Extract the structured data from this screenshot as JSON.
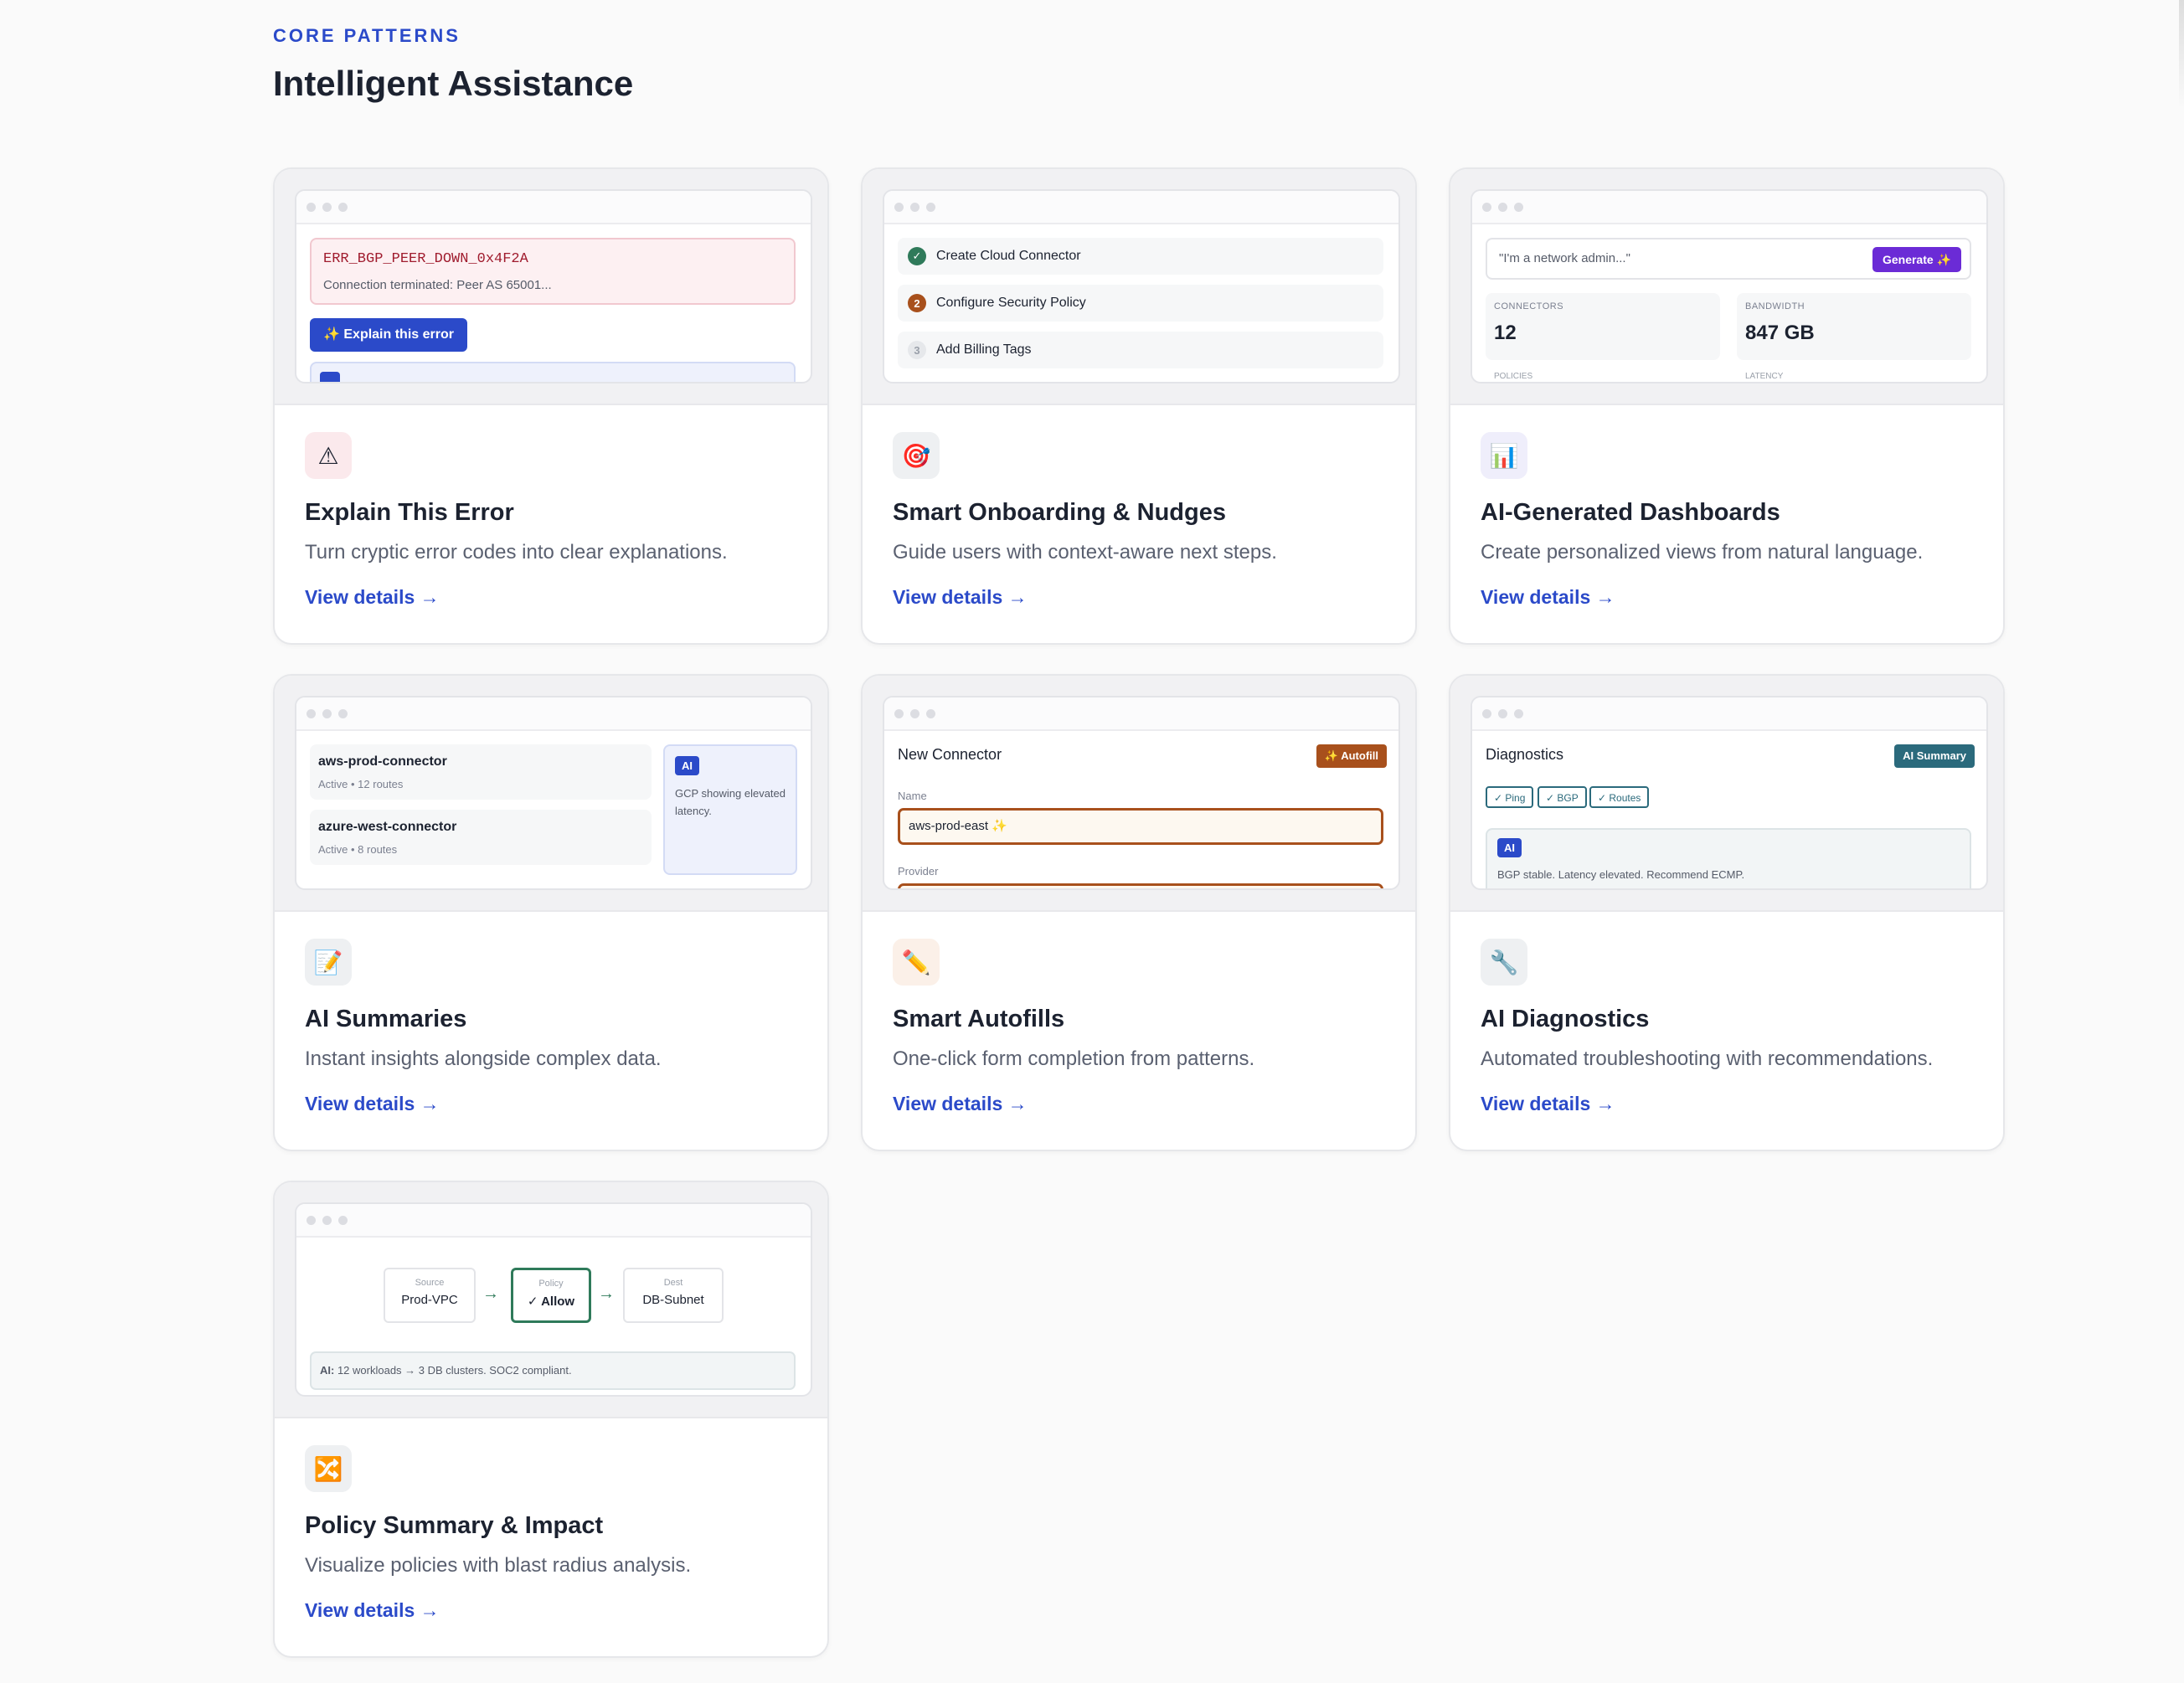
{
  "header": {
    "eyebrow": "CORE PATTERNS",
    "title": "Intelligent Assistance"
  },
  "colors": {
    "accent": "#2b4ac9",
    "error": "#a01c2e",
    "success": "#2f7a5a",
    "autofill": "#a8501c",
    "purple": "#6b2bd6",
    "teal": "#2b6a7c"
  },
  "cards": [
    {
      "icon": "⚠",
      "icon_name": "warning-icon",
      "icon_bg": "#fbe9ec",
      "title": "Explain This Error",
      "desc": "Turn cryptic error codes into clear explanations.",
      "link": "View details →",
      "preview": {
        "code": "ERR_BGP_PEER_DOWN_0x4F2A",
        "message": "Connection terminated: Peer AS 65001...",
        "button": "✨ Explain this error"
      }
    },
    {
      "icon": "🎯",
      "icon_name": "target-icon",
      "icon_bg": "#eef0f2",
      "title": "Smart Onboarding & Nudges",
      "desc": "Guide users with context-aware next steps.",
      "link": "View details →",
      "preview": {
        "steps": [
          {
            "badge": "✓",
            "label": "Create Cloud Connector"
          },
          {
            "badge": "2",
            "label": "Configure Security Policy"
          },
          {
            "badge": "3",
            "label": "Add Billing Tags"
          }
        ]
      }
    },
    {
      "icon": "📊",
      "icon_name": "bar-chart-icon",
      "icon_bg": "#efeefb",
      "title": "AI-Generated Dashboards",
      "desc": "Create personalized views from natural language.",
      "link": "View details →",
      "preview": {
        "prompt": "\"I'm a network admin...\"",
        "button": "Generate ✨",
        "stats": [
          {
            "label": "CONNECTORS",
            "value": "12"
          },
          {
            "label": "BANDWIDTH",
            "value": "847 GB"
          }
        ],
        "peek": [
          "POLICIES",
          "LATENCY"
        ]
      }
    },
    {
      "icon": "📝",
      "icon_name": "memo-icon",
      "icon_bg": "#eef0f2",
      "title": "AI Summaries",
      "desc": "Instant insights alongside complex data.",
      "link": "View details →",
      "preview": {
        "connectors": [
          {
            "name": "aws-prod-connector",
            "meta": "Active • 12 routes"
          },
          {
            "name": "azure-west-connector",
            "meta": "Active • 8 routes"
          }
        ],
        "ai_badge": "AI",
        "ai_text": "GCP showing elevated latency."
      }
    },
    {
      "icon": "✏️",
      "icon_name": "pencil-icon",
      "icon_bg": "#fbf0e8",
      "title": "Smart Autofills",
      "desc": "One-click form completion from patterns.",
      "link": "View details →",
      "preview": {
        "form_title": "New Connector",
        "badge": "✨ Autofill",
        "name_label": "Name",
        "name_value": "aws-prod-east ✨",
        "provider_label": "Provider"
      }
    },
    {
      "icon": "🔧",
      "icon_name": "wrench-icon",
      "icon_bg": "#eef0f2",
      "title": "AI Diagnostics",
      "desc": "Automated troubleshooting with recommendations.",
      "link": "View details →",
      "preview": {
        "title": "Diagnostics",
        "badge": "AI Summary",
        "chips": [
          "✓ Ping",
          "✓ BGP",
          "✓ Routes"
        ],
        "ai_badge": "AI",
        "text": "BGP stable. Latency elevated. Recommend ECMP."
      }
    },
    {
      "icon": "🔀",
      "icon_name": "shuffle-icon",
      "icon_bg": "#eef0f2",
      "title": "Policy Summary & Impact",
      "desc": "Visualize policies with blast radius analysis.",
      "link": "View details →",
      "preview": {
        "nodes": [
          {
            "label": "Source",
            "value": "Prod-VPC"
          },
          {
            "label": "Policy",
            "value": "✓ Allow"
          },
          {
            "label": "Dest",
            "value": "DB-Subnet"
          }
        ],
        "arrow": "→",
        "summary_prefix": "AI:",
        "summary": " 12 workloads → 3 DB clusters. SOC2 compliant."
      }
    }
  ]
}
